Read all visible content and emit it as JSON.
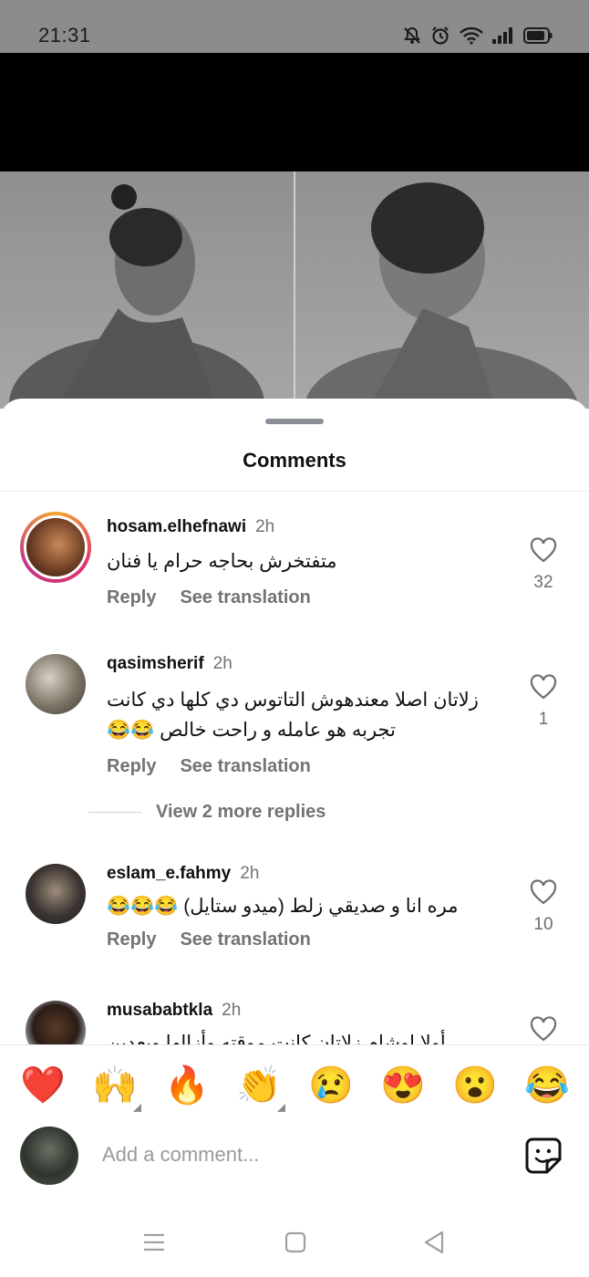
{
  "status_bar": {
    "time": "21:31",
    "icons": [
      "mute-icon",
      "alarm-icon",
      "wifi-icon",
      "signal-icon",
      "battery-icon"
    ]
  },
  "sheet": {
    "title": "Comments"
  },
  "comments": [
    {
      "username": "hosam.elhefnawi",
      "time": "2h",
      "text": "متفتخرش بحاجه حرام يا فنان",
      "reply": "Reply",
      "translate": "See translation",
      "likes": "32",
      "has_story_ring": true
    },
    {
      "username": "qasimsherif",
      "time": "2h",
      "text": "زلاتان اصلا معندهوش التاتوس دي كلها دي كانت تجربه هو عامله و راحت خالص 😂😂",
      "reply": "Reply",
      "translate": "See translation",
      "likes": "1",
      "view_more": "View 2 more replies"
    },
    {
      "username": "eslam_e.fahmy",
      "time": "2h",
      "text": "مره انا و صديقي زلط (ميدو ستايل) 😂😂😂",
      "reply": "Reply",
      "translate": "See translation",
      "likes": "10"
    },
    {
      "username": "musababtkla",
      "time": "2h",
      "text": "أولا اوشام زلاتان كانت موقته وأزالها وبعدين"
    }
  ],
  "emoji_bar": [
    "❤️",
    "🙌",
    "🔥",
    "👏",
    "😢",
    "😍",
    "😮",
    "😂"
  ],
  "composer": {
    "placeholder": "Add a comment..."
  },
  "colors": {
    "accent_text": "#111111",
    "muted_text": "#737373",
    "story_ring": "#e1306c"
  }
}
